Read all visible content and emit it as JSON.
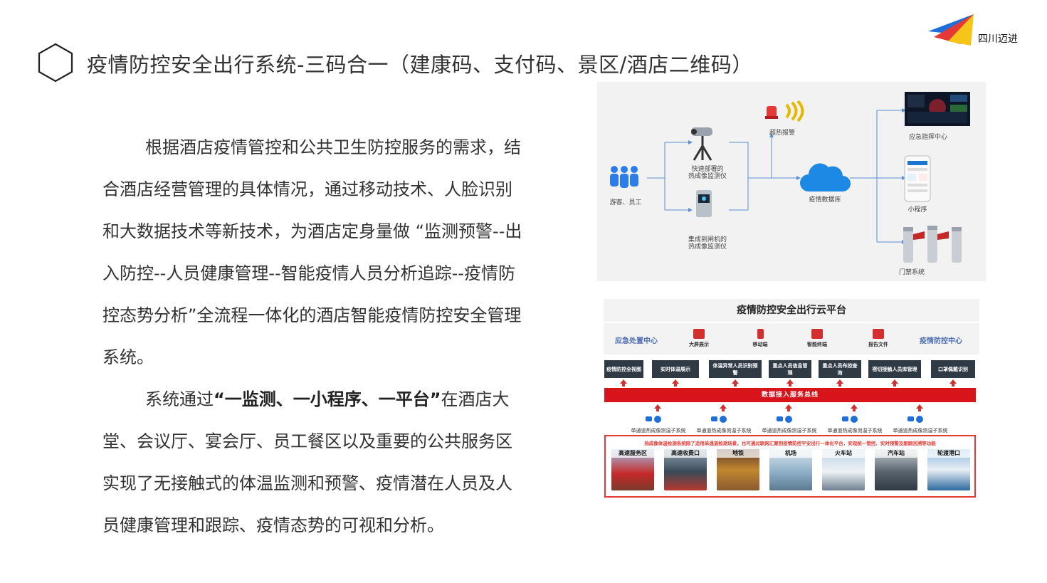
{
  "header": {
    "title": "疫情防控安全出行系统-三码合一（建康码、支付码、景区/酒店二维码）",
    "logo_text": "四川迈进"
  },
  "body": {
    "para1": "根据酒店疫情管控和公共卫生防控服务的需求，结合酒店经营管理的具体情况，通过移动技术、人脸识别和大数据技术等新技术，为酒店定身量做 “监测预警--出入防控--人员健康管理--智能疫情人员分析追踪--疫情防控态势分析”全流程一体化的酒店智能疫情防控安全管理系统。",
    "para2_prefix": "系统通过",
    "para2_bold": "“一监测、一小程序、一平台”",
    "para2_suffix": "在酒店大堂、会议厅、宴会厅、员工餐区以及重要的公共服务区实现了无接触式的体温监测和预警、疫情潜在人员及人员健康管理和跟踪、疫情态势的可视和分析。"
  },
  "diagram1": {
    "visitors": "游客、员工",
    "device1_line1": "快速部署的",
    "device1_line2": "热成像监测仪",
    "device2_line1": "集成到闸机的",
    "device2_line2": "热成像监测仪",
    "alarm": "超热报警",
    "database": "疫情数据库",
    "out1": "应急指挥中心",
    "out2": "小程序",
    "out3": "门禁系统"
  },
  "diagram2": {
    "title": "疫情防控安全出行云平台",
    "left_center": "应急处置中心",
    "right_center": "疫情防控中心",
    "top_icons": [
      "大屏展示",
      "移动端",
      "智能终端",
      "报告文件"
    ],
    "modules": [
      "疫情防控全视图",
      "实时体温展示",
      "体温异常人员识别预警",
      "重点人员信息管理",
      "重点人员布控查询",
      "密切接触人员库管理",
      "口罩佩戴识别"
    ],
    "bus": "数据接入服务总线",
    "subsystems": [
      "单通道热成像测温子系统",
      "单通道热成像测温子系统",
      "单通道热成像测温子系统",
      "单通道热成像测温子系统",
      "单通道热成像测温子系统"
    ],
    "red_text": "热成像体温检测系统除了适用单通道检测场景，也可通过联网汇聚到疫情防控平安出行一体化平台，实现统一管控、实时预警及跟踪回溯等功能",
    "scenes": [
      "高速服务区",
      "高速收费口",
      "地铁",
      "机场",
      "火车站",
      "汽车站",
      "轮渡港口"
    ]
  },
  "colors": {
    "accent_red": "#d8141b",
    "dark_box": "#2f3a45",
    "cloud_blue": "#1e88e5"
  }
}
